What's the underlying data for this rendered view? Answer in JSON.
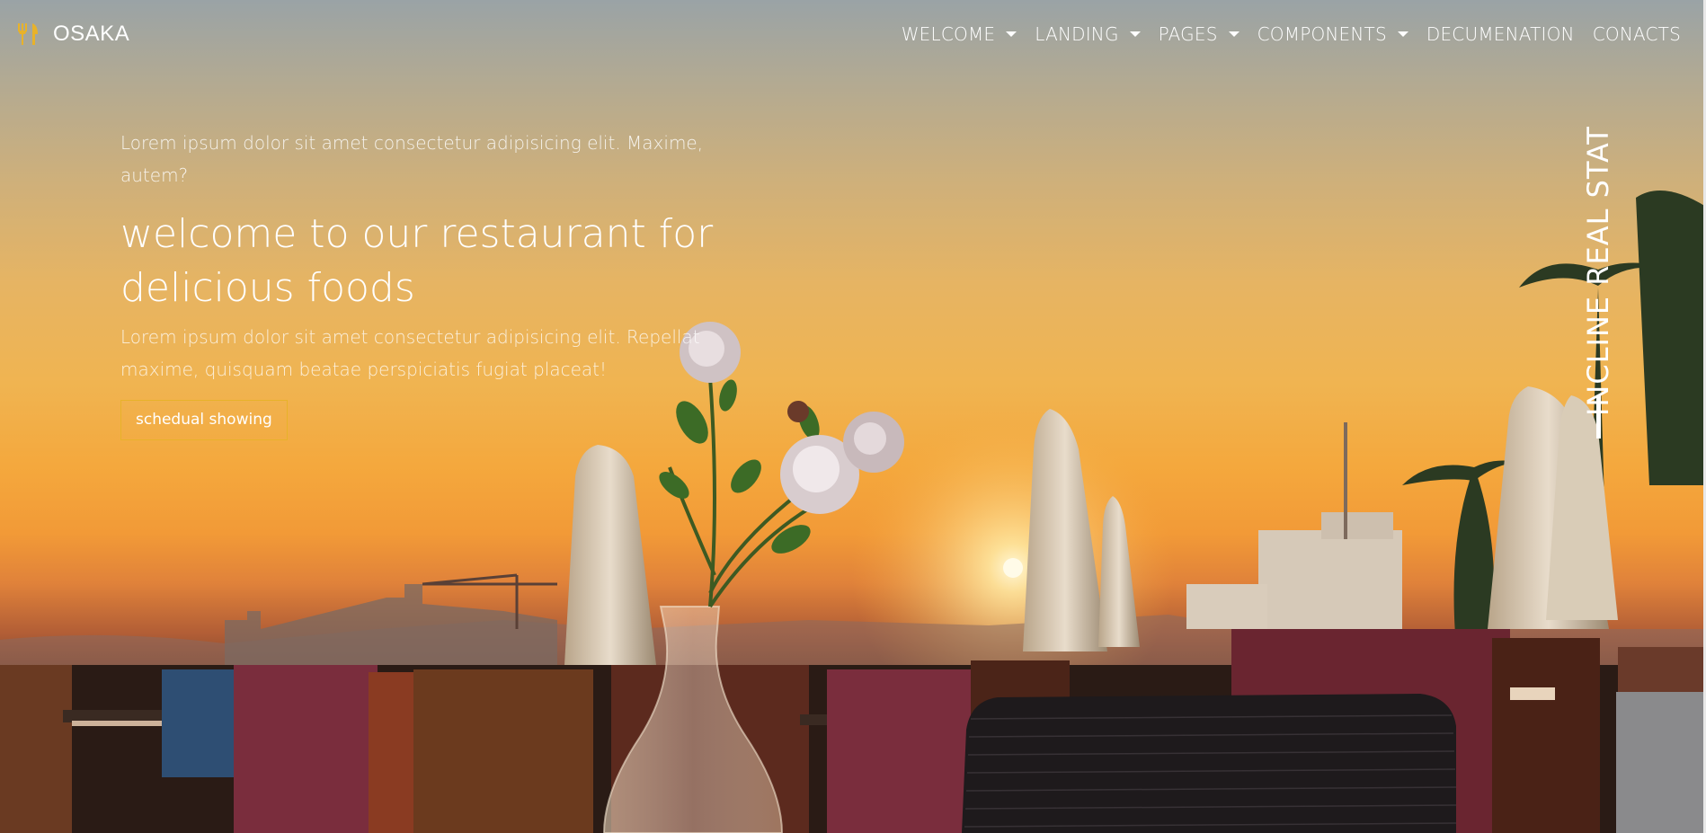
{
  "brand": {
    "name": "OSAKA",
    "icon": "cutlery-icon",
    "accent": "#e8b22a"
  },
  "nav": {
    "items": [
      {
        "label": "WELCOME",
        "dropdown": true
      },
      {
        "label": "LANDING",
        "dropdown": true
      },
      {
        "label": "PAGES",
        "dropdown": true
      },
      {
        "label": "COMPONENTS",
        "dropdown": true
      },
      {
        "label": "DECUMENATION",
        "dropdown": false
      },
      {
        "label": "CONACTS",
        "dropdown": false
      }
    ]
  },
  "hero": {
    "lead": "Lorem ipsum dolor sit amet consectetur adipisicing elit. Maxime, autem?",
    "title": "welcome to our restaurant for delicious foods",
    "description": "Lorem ipsum dolor sit amet consectetur adipisicing elit. Repellat maxime, quisquam beatae perspiciatis fugiat placeat!",
    "button_label": "schedual showing",
    "button_border_color": "#e8b22a"
  },
  "side_label": {
    "text": "INCLINE REAL STAT"
  },
  "background": {
    "description_colors": {
      "sky_top": "#9aa3a6",
      "sun": "#f4a83d",
      "ground": "#2a1a14"
    }
  }
}
